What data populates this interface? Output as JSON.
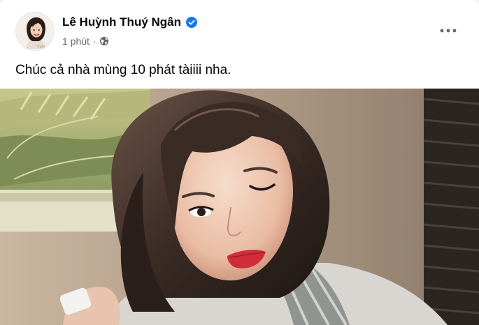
{
  "post": {
    "author": "Lê Huỳnh Thuý Ngân",
    "time": "1 phút",
    "separator": "·",
    "text": "Chúc cả nhà mùng 10 phát tàiiii nha."
  },
  "icons": {
    "verified": "verified-badge-icon",
    "privacy": "globe-icon",
    "more": "more-horizontal-icon"
  },
  "colors": {
    "verified_badge": "#1877f2",
    "meta_gray": "#65676b",
    "text": "#050505"
  }
}
